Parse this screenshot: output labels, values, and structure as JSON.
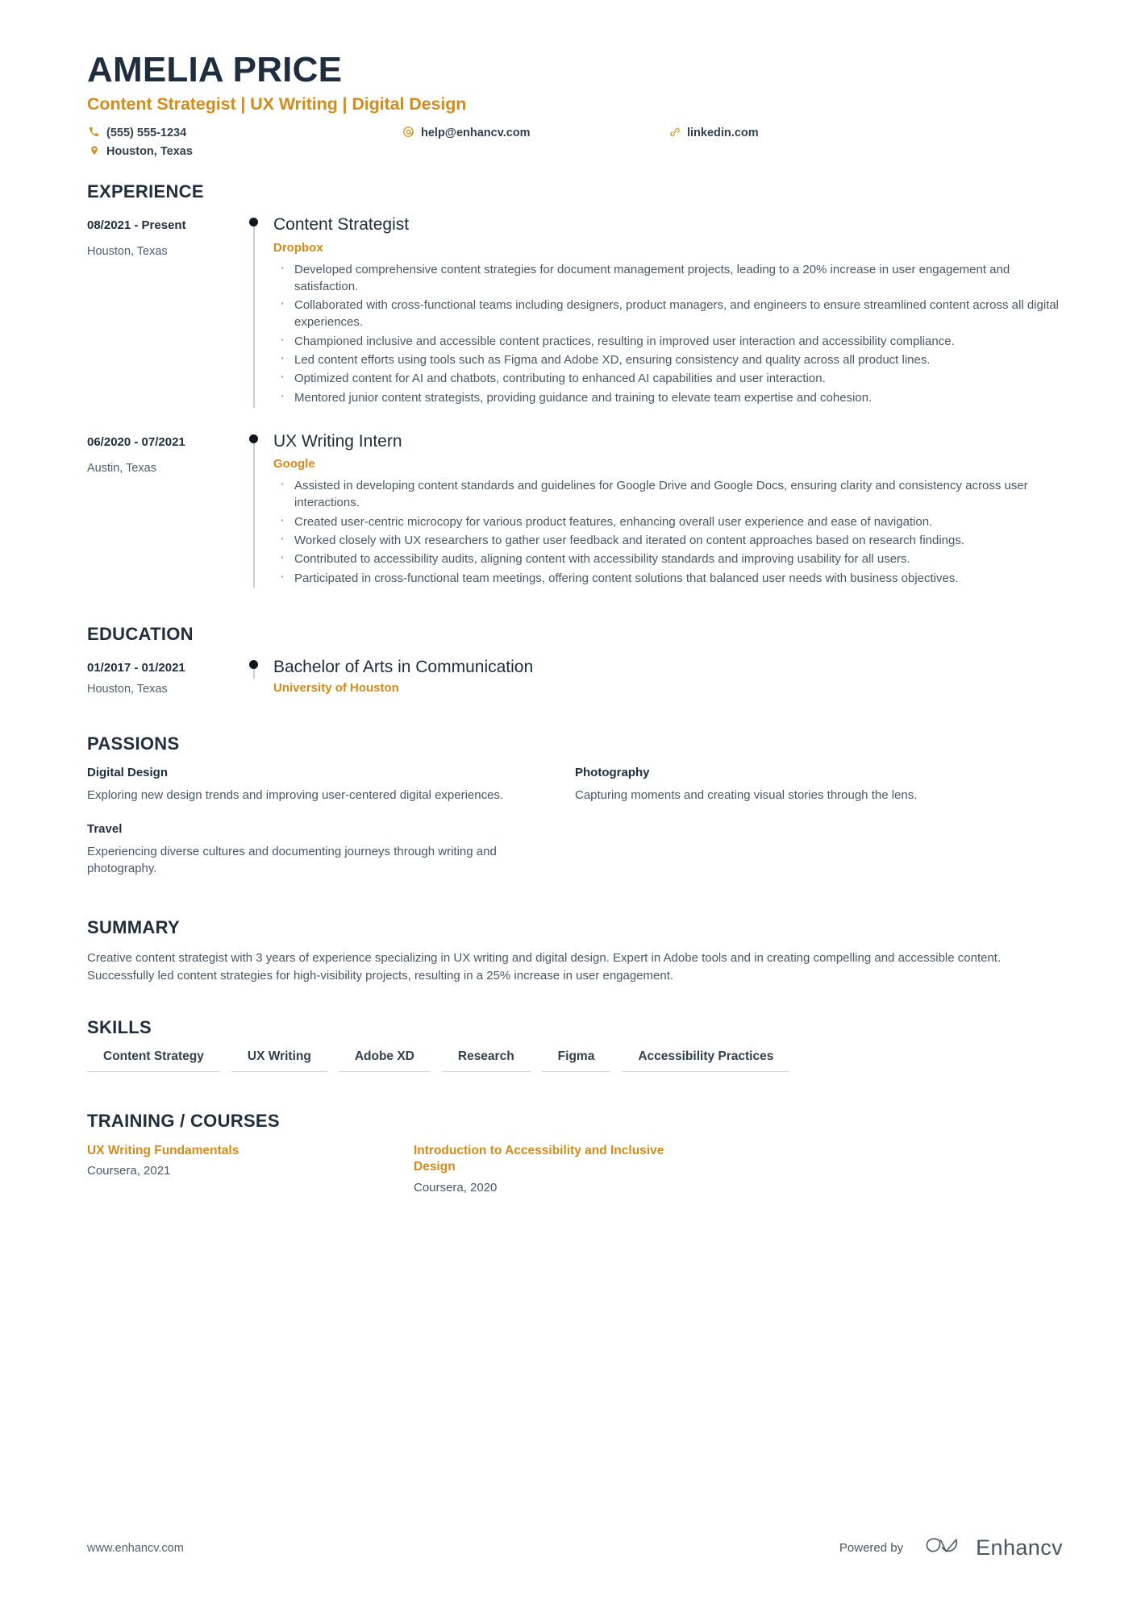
{
  "header": {
    "name": "AMELIA PRICE",
    "headline": "Content Strategist | UX Writing | Digital Design",
    "contacts": [
      {
        "icon": "phone-icon",
        "text": "(555) 555-1234"
      },
      {
        "icon": "email-icon",
        "text": "help@enhancv.com"
      },
      {
        "icon": "link-icon",
        "text": "linkedin.com"
      },
      {
        "icon": "location-pin-icon",
        "text": "Houston, Texas"
      }
    ]
  },
  "sections": {
    "experience": {
      "title": "EXPERIENCE",
      "entries": [
        {
          "date": "08/2021 - Present",
          "location": "Houston, Texas",
          "title": "Content Strategist",
          "organization": "Dropbox",
          "bullets": [
            "Developed comprehensive content strategies for document management projects, leading to a 20% increase in user engagement and satisfaction.",
            "Collaborated with cross-functional teams including designers, product managers, and engineers to ensure streamlined content across all digital experiences.",
            "Championed inclusive and accessible content practices, resulting in improved user interaction and accessibility compliance.",
            "Led content efforts using tools such as Figma and Adobe XD, ensuring consistency and quality across all product lines.",
            "Optimized content for AI and chatbots, contributing to enhanced AI capabilities and user interaction.",
            "Mentored junior content strategists, providing guidance and training to elevate team expertise and cohesion."
          ]
        },
        {
          "date": "06/2020 - 07/2021",
          "location": "Austin, Texas",
          "title": "UX Writing Intern",
          "organization": "Google",
          "bullets": [
            "Assisted in developing content standards and guidelines for Google Drive and Google Docs, ensuring clarity and consistency across user interactions.",
            "Created user-centric microcopy for various product features, enhancing overall user experience and ease of navigation.",
            "Worked closely with UX researchers to gather user feedback and iterated on content approaches based on research findings.",
            "Contributed to accessibility audits, aligning content with accessibility standards and improving usability for all users.",
            "Participated in cross-functional team meetings, offering content solutions that balanced user needs with business objectives."
          ]
        }
      ]
    },
    "education": {
      "title": "EDUCATION",
      "entries": [
        {
          "date": "01/2017 - 01/2021",
          "location": "Houston, Texas",
          "title": "Bachelor of Arts in Communication",
          "organization": "University of Houston"
        }
      ]
    },
    "passions": {
      "title": "PASSIONS",
      "items": [
        {
          "title": "Digital Design",
          "description": "Exploring new design trends and improving user-centered digital experiences."
        },
        {
          "title": "Photography",
          "description": "Capturing moments and creating visual stories through the lens."
        },
        {
          "title": "Travel",
          "description": "Experiencing diverse cultures and documenting journeys through writing and photography."
        }
      ]
    },
    "summary": {
      "title": "SUMMARY",
      "text": "Creative content strategist with 3 years of experience specializing in UX writing and digital design. Expert in Adobe tools and in creating compelling and accessible content. Successfully led content strategies for high-visibility projects, resulting in a 25% increase in user engagement."
    },
    "skills": {
      "title": "SKILLS",
      "items": [
        "Content Strategy",
        "UX Writing",
        "Adobe XD",
        "Research",
        "Figma",
        "Accessibility Practices"
      ]
    },
    "courses": {
      "title": "TRAINING / COURSES",
      "items": [
        {
          "title": "UX Writing Fundamentals",
          "meta": "Coursera, 2021"
        },
        {
          "title": "Introduction to Accessibility and Inclusive Design",
          "meta": "Coursera, 2020"
        }
      ]
    }
  },
  "footer": {
    "url": "www.enhancv.com",
    "powered_by": "Powered by",
    "brand_name": "Enhancv",
    "brand_logo_icon": "enhancv-logo-icon"
  },
  "colors": {
    "accent": "#d38b19",
    "heading": "#1f2d3d",
    "body": "#4b5765"
  }
}
